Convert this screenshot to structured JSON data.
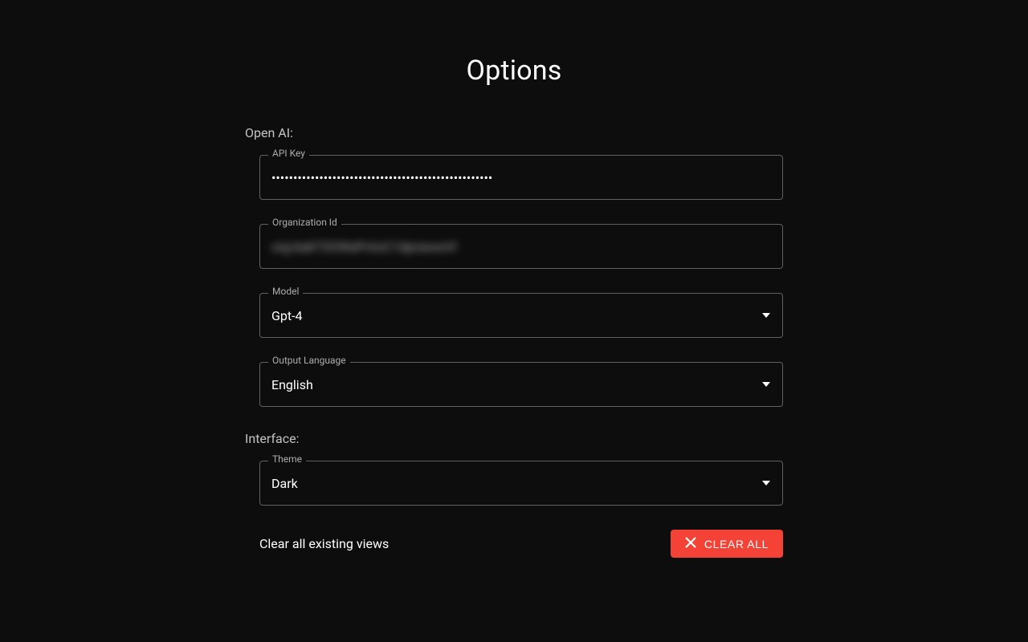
{
  "title": "Options",
  "sections": {
    "openai": {
      "label": "Open AI:",
      "api_key": {
        "label": "API Key",
        "value": "•••••••••••••••••••••••••••••••••••••••••••••••••••"
      },
      "org_id": {
        "label": "Organization Id",
        "value": "org-bakT3OWaPrAxC1dprawxmf"
      },
      "model": {
        "label": "Model",
        "value": "Gpt-4"
      },
      "output_language": {
        "label": "Output Language",
        "value": "English"
      }
    },
    "interface": {
      "label": "Interface:",
      "theme": {
        "label": "Theme",
        "value": "Dark"
      }
    }
  },
  "actions": {
    "clear_views": {
      "text": "Clear all existing views",
      "button": "CLEAR ALL"
    }
  }
}
